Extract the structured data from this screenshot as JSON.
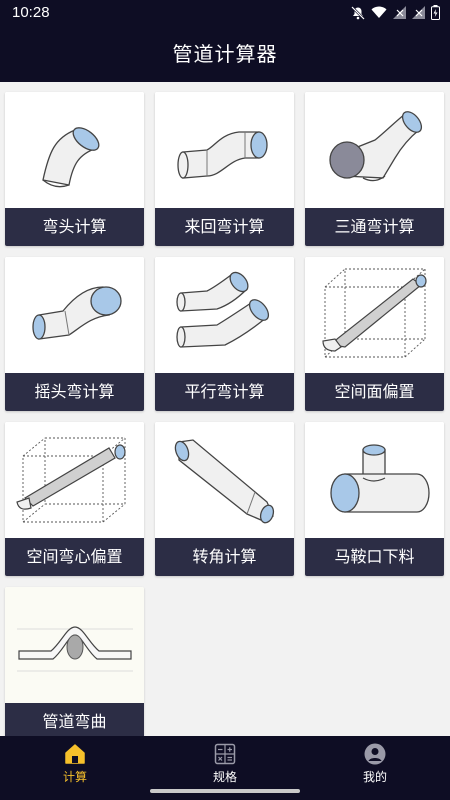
{
  "status_bar": {
    "time": "10:28"
  },
  "app_bar": {
    "title": "管道计算器"
  },
  "cards": [
    {
      "label": "弯头计算",
      "icon": "elbow-pipe-icon"
    },
    {
      "label": "来回弯计算",
      "icon": "offset-bend-pipe-icon"
    },
    {
      "label": "三通弯计算",
      "icon": "tee-bend-pipe-icon"
    },
    {
      "label": "摇头弯计算",
      "icon": "rolling-offset-pipe-icon"
    },
    {
      "label": "平行弯计算",
      "icon": "parallel-bend-pipe-icon"
    },
    {
      "label": "空间面偏置",
      "icon": "spatial-plane-offset-icon"
    },
    {
      "label": "空间弯心偏置",
      "icon": "spatial-bend-center-offset-icon"
    },
    {
      "label": "转角计算",
      "icon": "corner-angle-pipe-icon"
    },
    {
      "label": "马鞍口下料",
      "icon": "saddle-cut-pipe-icon"
    },
    {
      "label": "管道弯曲",
      "icon": "pipe-bending-icon"
    }
  ],
  "bottom_nav": [
    {
      "label": "计算",
      "icon": "home-icon",
      "active": true
    },
    {
      "label": "规格",
      "icon": "calculator-icon",
      "active": false
    },
    {
      "label": "我的",
      "icon": "user-icon",
      "active": false
    }
  ],
  "colors": {
    "nav_bg": "#0e0d24",
    "label_bg": "#2c2d45",
    "active": "#f6c02b",
    "pipe_end": "#a8c8e8"
  }
}
